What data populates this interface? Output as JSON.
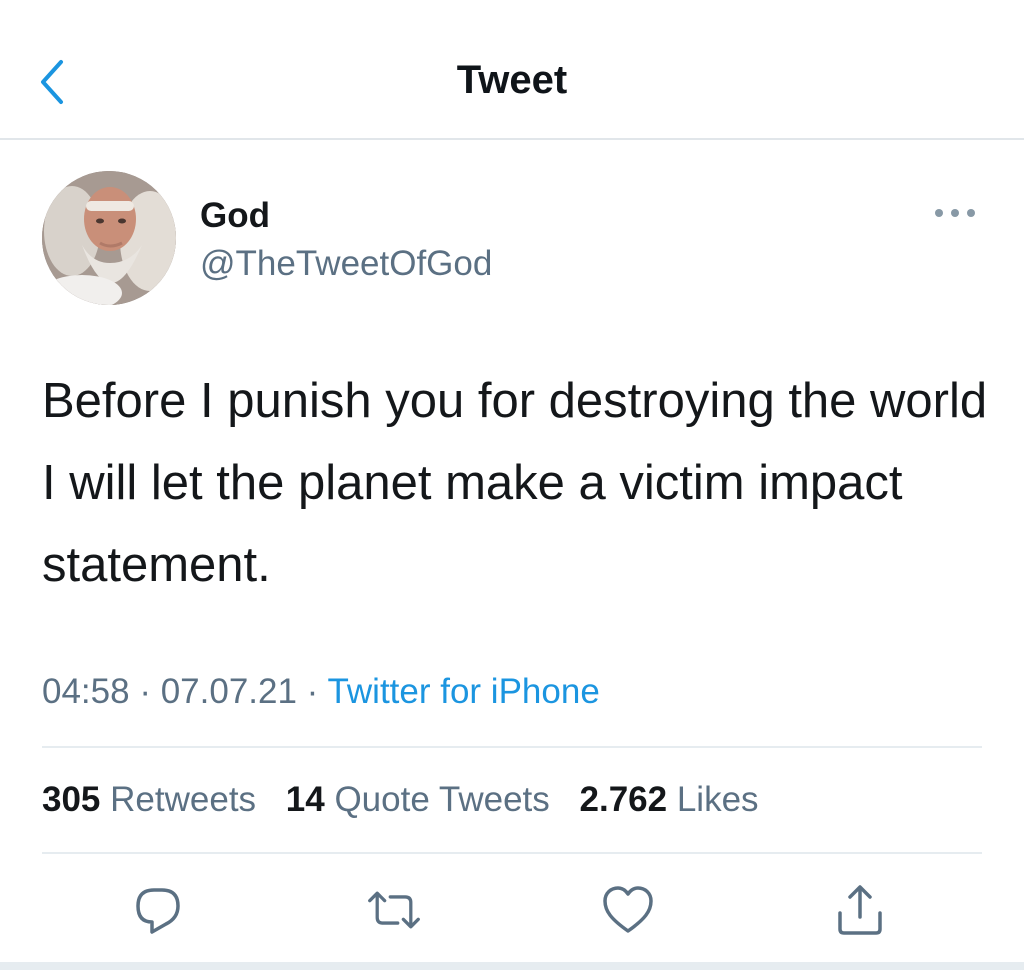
{
  "header": {
    "title": "Tweet",
    "back_icon": "chevron-left-icon"
  },
  "colors": {
    "accent": "#1b95e0",
    "text": "#14171a",
    "secondary": "#5b7083",
    "divider": "#e6ecf0"
  },
  "tweet": {
    "author": {
      "name": "God",
      "handle": "@TheTweetOfGod",
      "avatar_icon": "avatar-icon"
    },
    "text": "Before I punish you for destroying the world I will let the planet make a victim impact statement.",
    "time": "04:58",
    "date": "07.07.21",
    "source": "Twitter for iPhone",
    "separator": " · "
  },
  "stats": {
    "retweets": {
      "count": "305",
      "label": "Retweets"
    },
    "quote_tweets": {
      "count": "14",
      "label": "Quote Tweets"
    },
    "likes": {
      "count": "2.762",
      "label": "Likes"
    }
  },
  "actions": [
    {
      "name": "reply",
      "icon": "reply-icon"
    },
    {
      "name": "retweet",
      "icon": "retweet-icon"
    },
    {
      "name": "like",
      "icon": "heart-icon"
    },
    {
      "name": "share",
      "icon": "share-icon"
    }
  ]
}
